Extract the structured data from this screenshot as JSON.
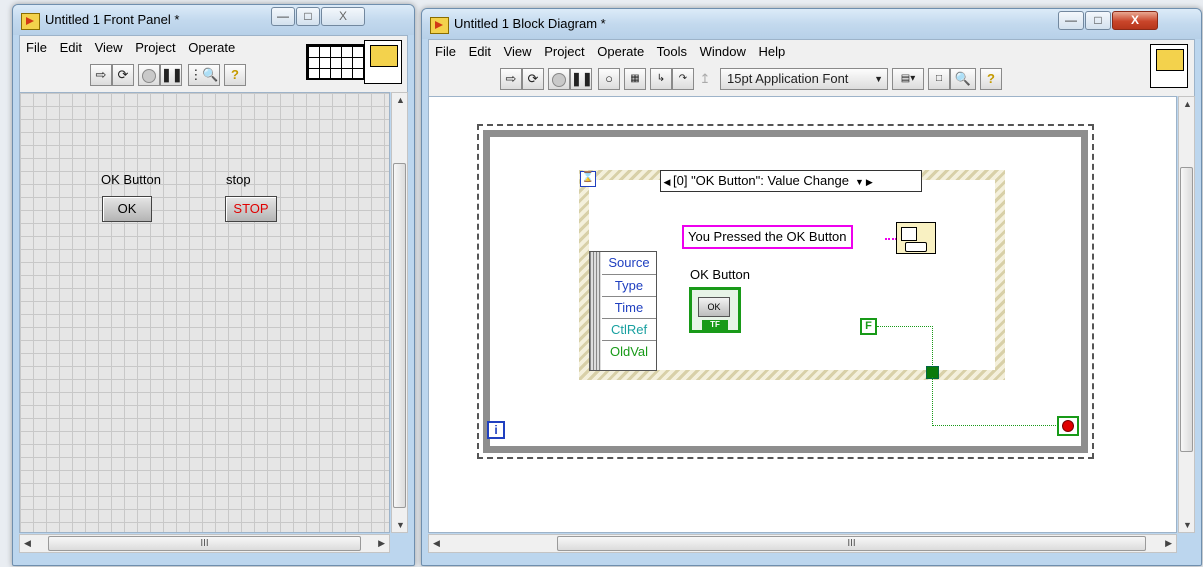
{
  "front_panel": {
    "title": "Untitled 1 Front Panel *",
    "win_buttons": {
      "minimize": "—",
      "maximize": "□",
      "close": "X"
    },
    "menu": [
      "File",
      "Edit",
      "View",
      "Project",
      "Operate"
    ],
    "controls": {
      "ok_label": "OK Button",
      "ok_text": "OK",
      "stop_label": "stop",
      "stop_text": "STOP"
    },
    "hscroll_grip": "III"
  },
  "block_diagram": {
    "title": "Untitled 1 Block Diagram *",
    "win_buttons": {
      "minimize": "—",
      "maximize": "□",
      "close": "X"
    },
    "menu": [
      "File",
      "Edit",
      "View",
      "Project",
      "Operate",
      "Tools",
      "Window",
      "Help"
    ],
    "font_selector": "15pt Application Font",
    "event_case": "[0] \"OK Button\": Value Change",
    "string_constant": "You Pressed the OK Button",
    "event_data": [
      "Source",
      "Type",
      "Time",
      "CtlRef",
      "OldVal"
    ],
    "terminal_label": "OK Button",
    "terminal_text": "OK",
    "terminal_type": "TF",
    "false_constant": "F",
    "iteration_terminal": "i",
    "hscroll_grip": "III"
  },
  "colors": {
    "bool_wire": "#189a18",
    "string_wire": "#ee00ee",
    "stop_red": "#e00000"
  }
}
